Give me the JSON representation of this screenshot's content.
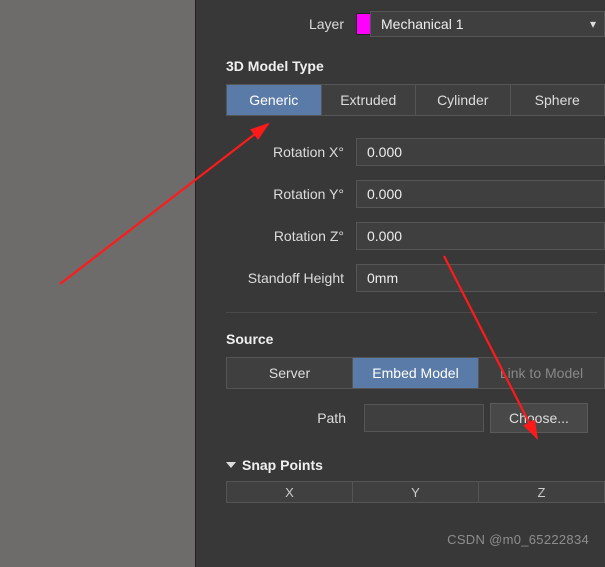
{
  "layer": {
    "label": "Layer",
    "value": "Mechanical 1",
    "swatch_color": "#ff00ff"
  },
  "model_type": {
    "header": "3D Model Type",
    "tabs": [
      "Generic",
      "Extruded",
      "Cylinder",
      "Sphere"
    ],
    "active": "Generic"
  },
  "rotation": {
    "x": {
      "label": "Rotation X°",
      "value": "0.000"
    },
    "y": {
      "label": "Rotation Y°",
      "value": "0.000"
    },
    "z": {
      "label": "Rotation Z°",
      "value": "0.000"
    }
  },
  "standoff": {
    "label": "Standoff Height",
    "value": "0mm"
  },
  "source": {
    "header": "Source",
    "tabs": [
      "Server",
      "Embed Model",
      "Link to Model"
    ],
    "active": "Embed Model",
    "path_label": "Path",
    "choose_label": "Choose..."
  },
  "snap": {
    "header": "Snap Points",
    "cols": [
      "X",
      "Y",
      "Z"
    ]
  },
  "watermark": "CSDN @m0_65222834"
}
